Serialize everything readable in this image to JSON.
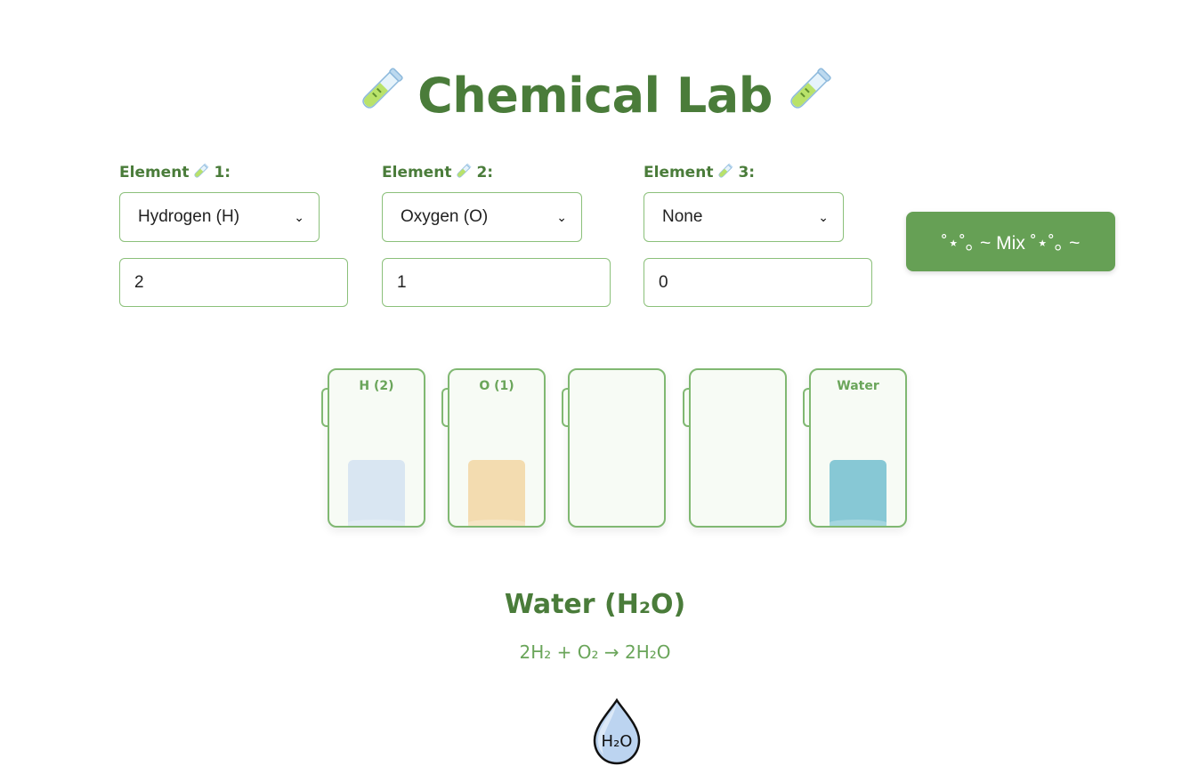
{
  "title": "Chemical Lab",
  "title_icon": "test-tube-icon",
  "elements": [
    {
      "label": "Element",
      "number": "1:",
      "selected": "Hydrogen (H)",
      "amount": "2"
    },
    {
      "label": "Element",
      "number": "2:",
      "selected": "Oxygen (O)",
      "amount": "1"
    },
    {
      "label": "Element",
      "number": "3:",
      "selected": "None",
      "amount": "0"
    }
  ],
  "mix_label": "˚⋆˚｡ ~ Mix ˚⋆˚｡ ~",
  "beakers": [
    {
      "label": "H (2)",
      "liquid_color": "#d9e6f2",
      "fill": 0.42
    },
    {
      "label": "O (1)",
      "liquid_color": "#f3dcb0",
      "fill": 0.42
    },
    {
      "label": "",
      "liquid_color": "",
      "fill": 0
    },
    {
      "label": "",
      "liquid_color": "",
      "fill": 0
    },
    {
      "label": "Water",
      "liquid_color": "#87c8d5",
      "fill": 0.42
    }
  ],
  "result": {
    "name": "Water (H₂O)",
    "equation": "2H₂ + O₂ → 2H₂O",
    "icon": "water-drop-icon",
    "icon_text": "H₂O"
  },
  "colors": {
    "accent": "#4a7c3a",
    "button": "#66a055",
    "border": "#80b872"
  }
}
